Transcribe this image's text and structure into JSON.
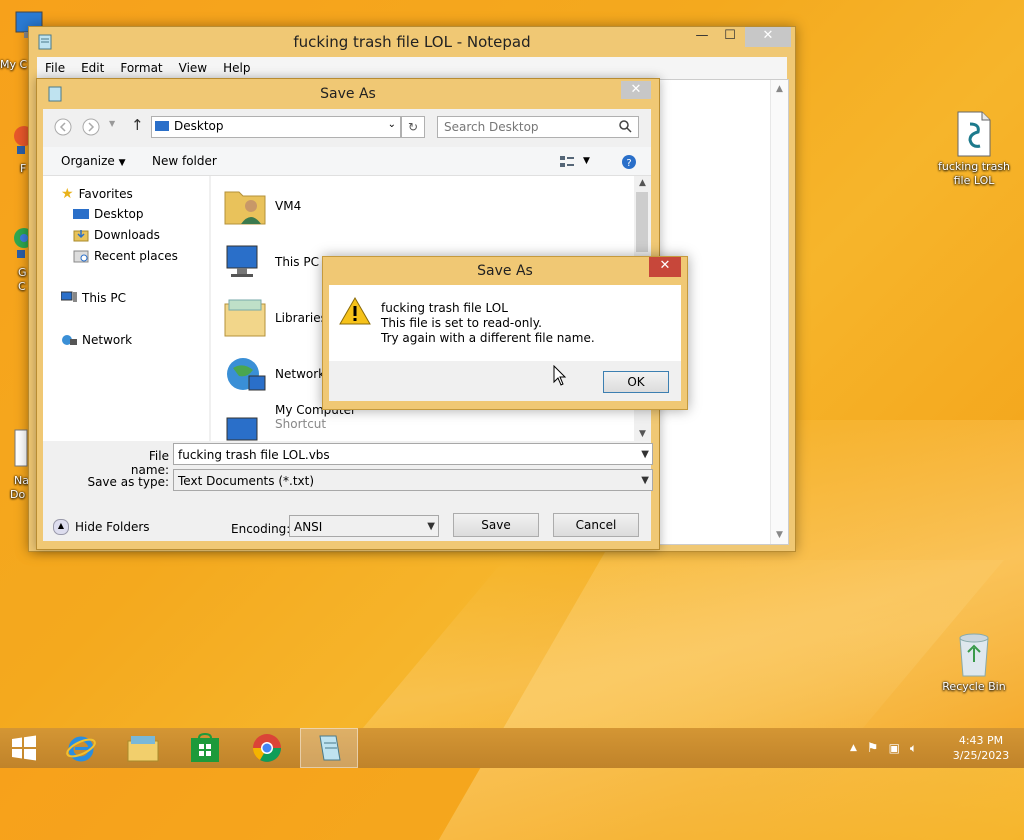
{
  "desktop": {
    "icons": [
      {
        "label": "My C",
        "name": "my-computer"
      },
      {
        "label": "F",
        "name": "firefox"
      },
      {
        "label": "G",
        "name": "chrome"
      },
      {
        "label": "C",
        "name": "chrome2"
      },
      {
        "label": "Na",
        "name": "na"
      },
      {
        "label": "Do",
        "name": "do"
      },
      {
        "label": "fucking trash file LOL",
        "name": "script-file"
      },
      {
        "label": "Recycle Bin",
        "name": "recycle-bin"
      }
    ]
  },
  "notepad": {
    "title": "fucking trash file LOL - Notepad",
    "menu": [
      "File",
      "Edit",
      "Format",
      "View",
      "Help"
    ],
    "caption": {
      "min": "—",
      "max": "☐",
      "close": "✕"
    }
  },
  "save_dialog": {
    "title": "Save As",
    "address": "Desktop",
    "search_placeholder": "Search Desktop",
    "organize": "Organize",
    "new_folder": "New folder",
    "nav": {
      "favorites": "Favorites",
      "desktop": "Desktop",
      "downloads": "Downloads",
      "recent": "Recent places",
      "this_pc": "This PC",
      "network": "Network"
    },
    "files": [
      {
        "label": "VM4"
      },
      {
        "label": "This PC"
      },
      {
        "label": "Libraries"
      },
      {
        "label": "Network"
      },
      {
        "label": "My Computer",
        "sub": "Shortcut"
      }
    ],
    "file_name_label": "File name:",
    "file_name": "fucking trash file LOL.vbs",
    "save_type_label": "Save as type:",
    "save_type": "Text Documents (*.txt)",
    "hide_folders": "Hide Folders",
    "encoding_label": "Encoding:",
    "encoding": "ANSI",
    "save": "Save",
    "cancel": "Cancel"
  },
  "message_box": {
    "title": "Save As",
    "line1": "fucking trash file LOL",
    "line2": "This file is set to read-only.",
    "line3": "Try again with a different file name.",
    "ok": "OK"
  },
  "taskbar": {
    "time": "4:43 PM",
    "date": "3/25/2023"
  }
}
